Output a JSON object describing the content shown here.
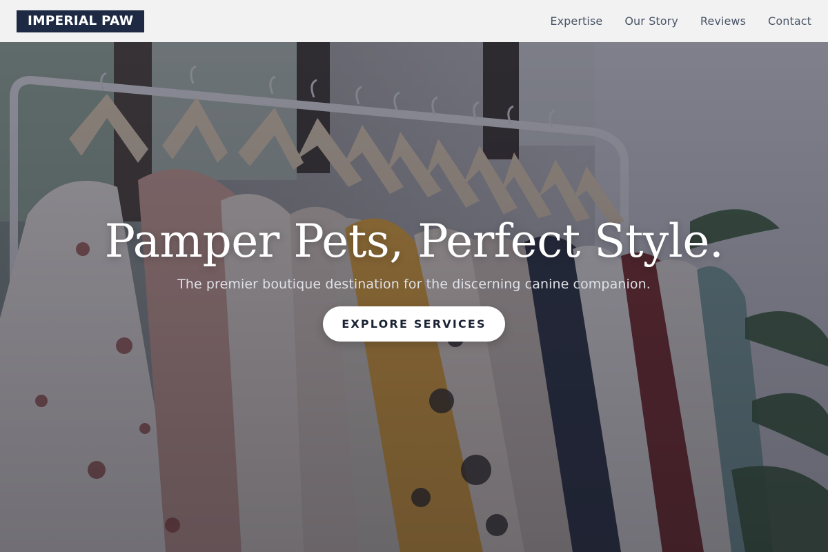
{
  "brand": {
    "logo_text": "IMPERIAL PAW"
  },
  "nav": {
    "items": [
      {
        "label": "Expertise"
      },
      {
        "label": "Our Story"
      },
      {
        "label": "Reviews"
      },
      {
        "label": "Contact"
      }
    ]
  },
  "hero": {
    "title": "Pamper Pets, Perfect Style.",
    "subtitle": "The premier boutique destination for the discerning canine companion.",
    "cta_label": "EXPLORE SERVICES",
    "background_image": "clothing-rack-photo"
  },
  "colors": {
    "navbar_bg": "#f2f2f2",
    "logo_bg": "#1e2a44",
    "logo_text": "#ffffff",
    "nav_text": "#4a5568",
    "hero_overlay": "#1c2032",
    "cta_bg": "#ffffff",
    "cta_text": "#1a2233"
  }
}
